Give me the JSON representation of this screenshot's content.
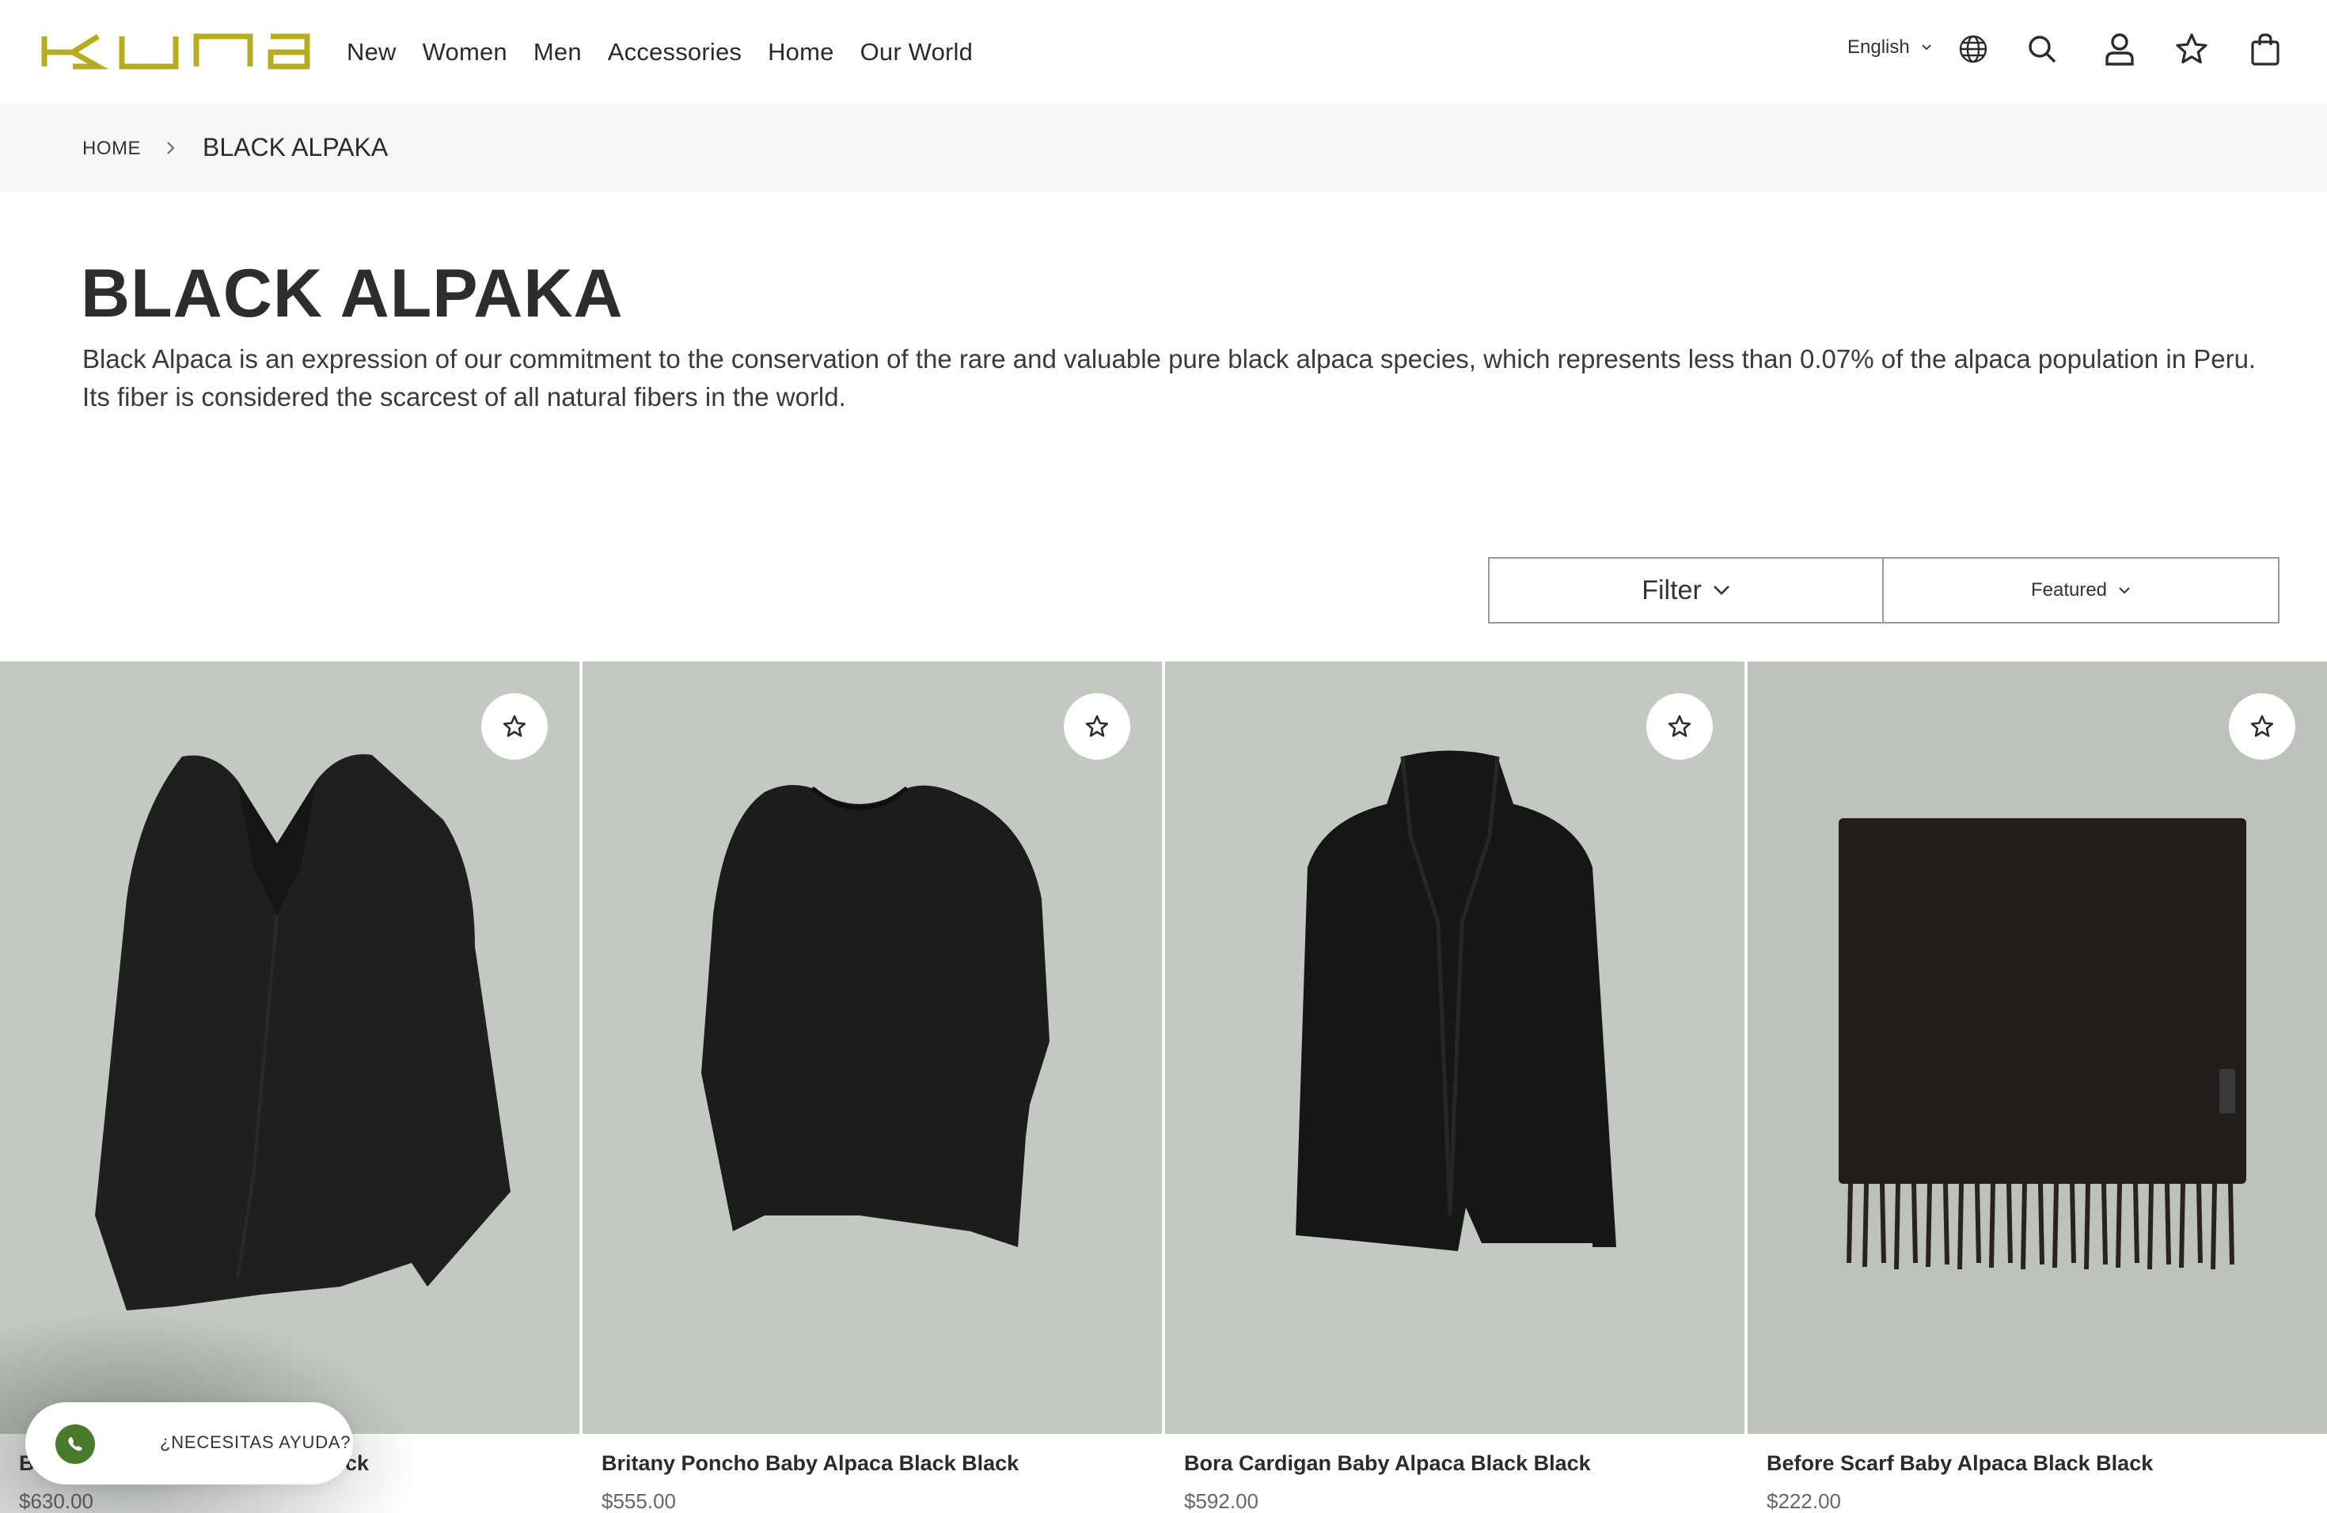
{
  "header": {
    "logo_text": "KUNA",
    "nav": [
      "New",
      "Women",
      "Men",
      "Accessories",
      "Home",
      "Our World"
    ],
    "language": "English",
    "icons": [
      "globe-icon",
      "search-icon",
      "user-icon",
      "star-icon",
      "bag-icon"
    ]
  },
  "breadcrumb": {
    "home": "HOME",
    "current": "BLACK ALPAKA"
  },
  "collection": {
    "title": "BLACK ALPAKA",
    "description": "Black Alpaca is an expression of our commitment to the conservation of the rare and valuable pure black alpaca species, which represents less than 0.07% of the alpaca population in Peru. Its fiber is considered the scarcest of all natural fibers in the world."
  },
  "toolbar": {
    "filter_label": "Filter",
    "sort_label": "Featured"
  },
  "products": [
    {
      "name_visible_start": "B",
      "name_visible_end": "ck",
      "price": "$630.00"
    },
    {
      "name": "Britany Poncho Baby Alpaca Black Black",
      "price": "$555.00"
    },
    {
      "name": "Bora Cardigan Baby Alpaca Black Black",
      "price": "$592.00"
    },
    {
      "name": "Before Scarf Baby Alpaca Black Black",
      "price": "$222.00"
    }
  ],
  "help_widget": {
    "label": "¿NECESITAS AYUDA?"
  },
  "colors": {
    "brand": "#b5ad1f",
    "product_bg": "#c2c9c1",
    "breadcrumb_bg": "#f7f7f7",
    "whatsapp": "#4a7a2a"
  }
}
